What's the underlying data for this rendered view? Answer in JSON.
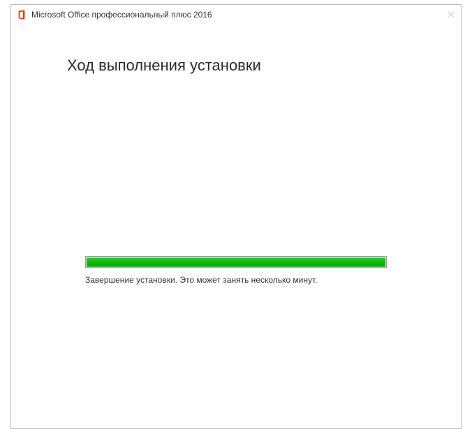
{
  "window": {
    "title": "Microsoft Office профессиональный плюс 2016"
  },
  "main": {
    "heading": "Ход выполнения установки",
    "status": "Завершение установки. Это может занять несколько минут.",
    "progress_percent": 100
  },
  "colors": {
    "accent": "#d83b01",
    "progress": "#0fbe0f"
  }
}
